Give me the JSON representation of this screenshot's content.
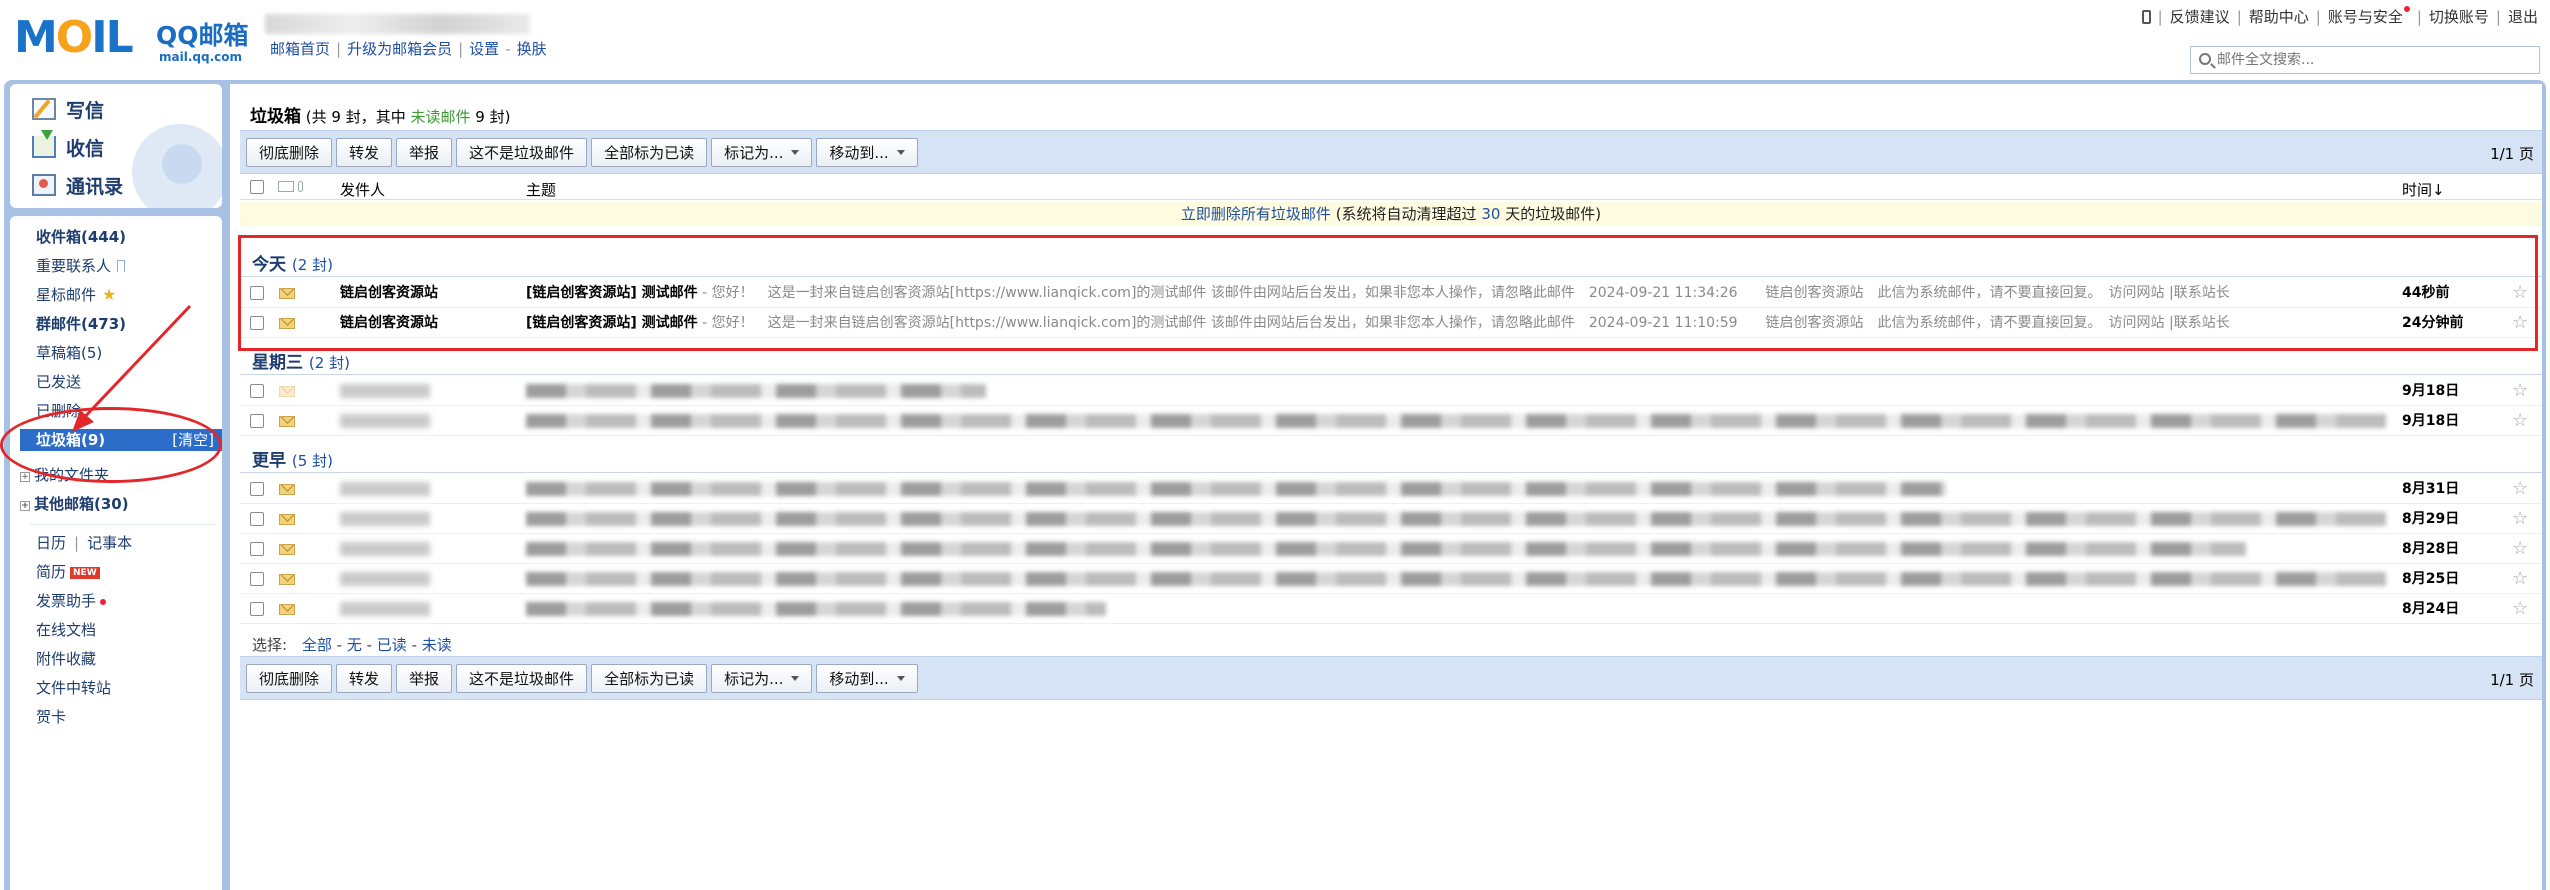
{
  "header": {
    "logo_text": "MOIL",
    "logo_brand": "QQ邮箱",
    "logo_url": "mail.qq.com",
    "links": [
      "邮箱首页",
      "升级为邮箱会员",
      "设置",
      "换肤"
    ],
    "right_links": [
      "反馈建议",
      "帮助中心",
      "账号与安全",
      "切换账号",
      "退出"
    ],
    "search_placeholder": "邮件全文搜索..."
  },
  "sidebar": {
    "actions": [
      "写信",
      "收信",
      "通讯录"
    ],
    "folders": [
      {
        "label": "收件箱(444)",
        "bold": true
      },
      {
        "label": "重要联系人"
      },
      {
        "label": "星标邮件"
      },
      {
        "label": "群邮件(473)",
        "bold": true
      },
      {
        "label": "草稿箱(5)"
      },
      {
        "label": "已发送"
      },
      {
        "label": "已删除"
      },
      {
        "label": "垃圾箱(9)",
        "active": true,
        "clear": "[清空]"
      },
      {
        "label": "我的文件夹"
      },
      {
        "label": "其他邮箱(30)",
        "bold": true
      }
    ],
    "tools": {
      "calendar": "日历",
      "notes": "记事本",
      "resume": "简历",
      "new_badge": "NEW",
      "invoice": "发票助手",
      "docs": "在线文档",
      "attachments": "附件收藏",
      "transfer": "文件中转站",
      "cards": "贺卡"
    }
  },
  "main": {
    "title": "垃圾箱",
    "title_prefix": "(共 9 封，其中",
    "unread_link": "未读邮件",
    "title_suffix": "9 封)",
    "toolbar": {
      "buttons": [
        "彻底删除",
        "转发",
        "举报",
        "这不是垃圾邮件",
        "全部标为已读",
        "标记为...",
        "移动到..."
      ],
      "page": "1/1 页"
    },
    "columns": {
      "sender": "发件人",
      "subject": "主题",
      "time": "时间↓"
    },
    "notice": {
      "prefix": "立即删除所有垃圾邮件",
      "mid": "(系统将自动清理超过",
      "days": "30",
      "suffix": "天的垃圾邮件)"
    },
    "groups": [
      {
        "title": "今天",
        "count": "(2 封)"
      },
      {
        "title": "星期三",
        "count": "(2 封)"
      },
      {
        "title": "更早",
        "count": "(5 封)"
      }
    ],
    "today_rows": [
      {
        "sender": "链启创客资源站",
        "subject": "[链启创客资源站] 测试邮件",
        "snippet": " - 您好！　这是一封来自链启创客资源站[https://www.lianqick.com]的测试邮件 该邮件由网站后台发出，如果非您本人操作，请忽略此邮件　2024-09-21 11:34:26　　链启创客资源站　此信为系统邮件，请不要直接回复。　访问网站 |联系站长",
        "time": "44秒前"
      },
      {
        "sender": "链启创客资源站",
        "subject": "[链启创客资源站] 测试邮件",
        "snippet": " - 您好！　这是一封来自链启创客资源站[https://www.lianqick.com]的测试邮件 该邮件由网站后台发出，如果非您本人操作，请忽略此邮件　2024-09-21 11:10:59　　链启创客资源站　此信为系统邮件，请不要直接回复。　访问网站 |联系站长",
        "time": "24分钟前"
      }
    ],
    "wed_times": [
      "9月18日",
      "9月18日"
    ],
    "earlier_times": [
      "8月31日",
      "8月29日",
      "8月28日",
      "8月25日",
      "8月24日"
    ],
    "select": {
      "label": "选择:",
      "all": "全部",
      "none": "无",
      "read": "已读",
      "unread": "未读"
    }
  }
}
